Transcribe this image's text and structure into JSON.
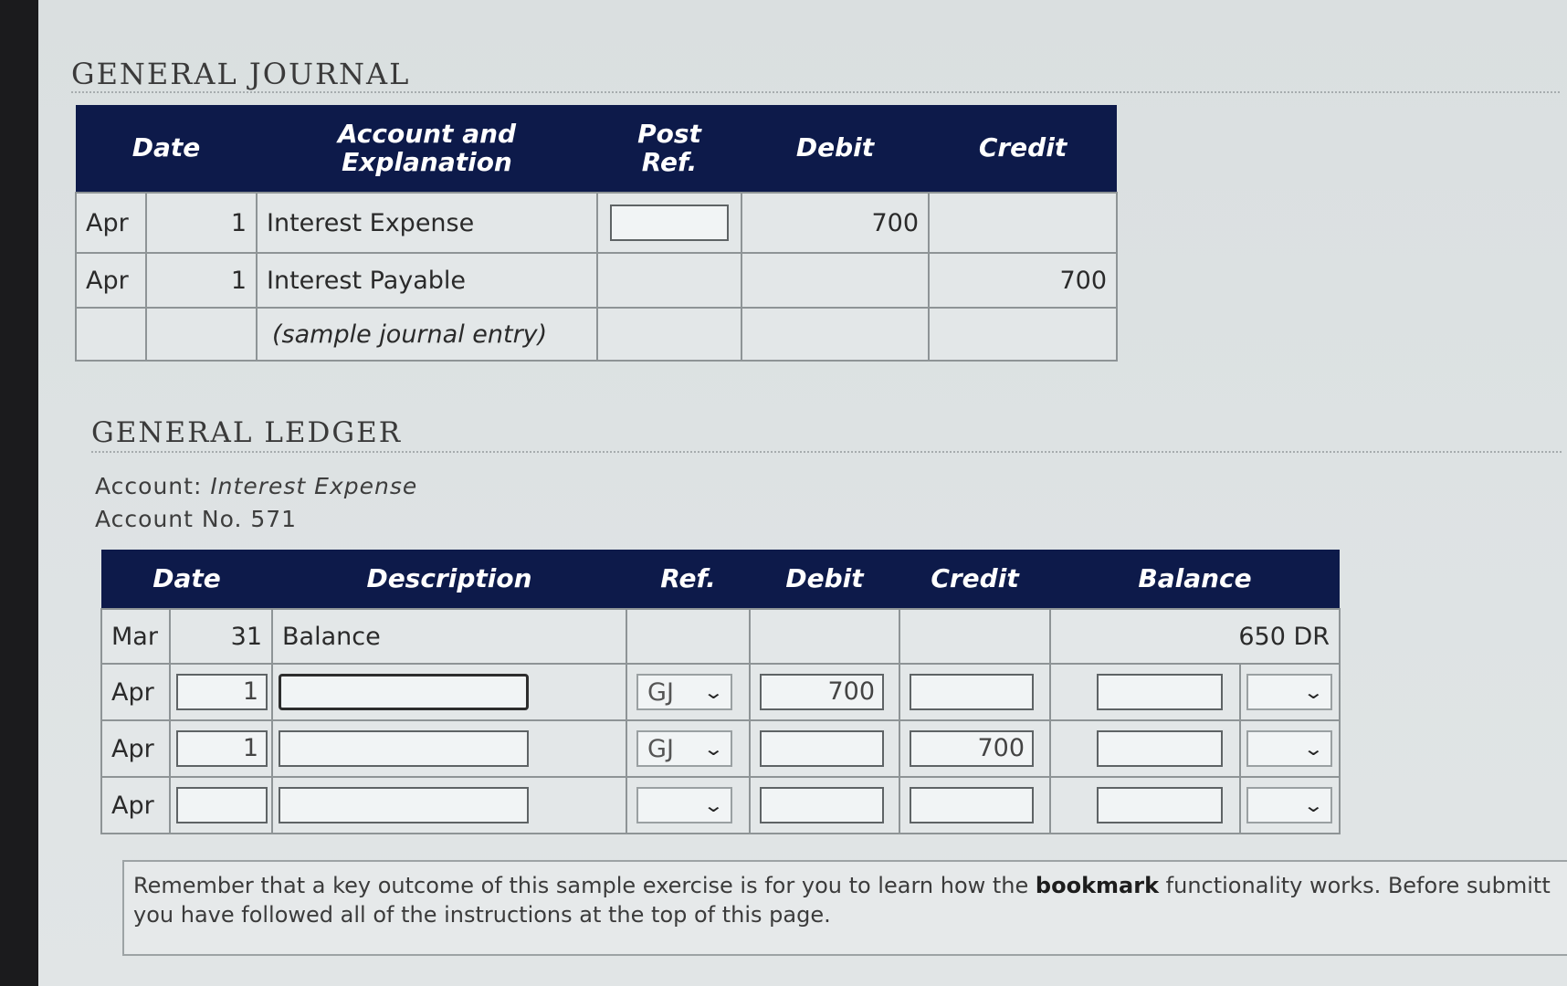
{
  "journal": {
    "title": "GENERAL JOURNAL",
    "headers": {
      "date": "Date",
      "account": "Account and Explanation",
      "post_ref_1": "Post",
      "post_ref_2": "Ref.",
      "debit": "Debit",
      "credit": "Credit"
    },
    "rows": [
      {
        "month": "Apr",
        "day": "1",
        "account": "Interest Expense",
        "debit": "700",
        "credit": ""
      },
      {
        "month": "Apr",
        "day": "1",
        "account": "Interest Payable",
        "debit": "",
        "credit": "700"
      },
      {
        "month": "",
        "day": "",
        "account": "(sample journal entry)",
        "debit": "",
        "credit": ""
      }
    ]
  },
  "ledger": {
    "title": "GENERAL LEDGER",
    "account_label": "Account: ",
    "account_name": "Interest Expense",
    "account_no": "Account No. 571",
    "headers": {
      "date": "Date",
      "description": "Description",
      "ref": "Ref.",
      "debit": "Debit",
      "credit": "Credit",
      "balance": "Balance"
    },
    "opening": {
      "month": "Mar",
      "day": "31",
      "description": "Balance",
      "balance": "650 DR"
    },
    "rows": [
      {
        "month": "Apr",
        "day": "1",
        "description": "",
        "ref": "GJ",
        "debit": "700",
        "credit": "",
        "balance": "",
        "balance_type": ""
      },
      {
        "month": "Apr",
        "day": "1",
        "description": "",
        "ref": "GJ",
        "debit": "",
        "credit": "700",
        "balance": "",
        "balance_type": ""
      },
      {
        "month": "Apr",
        "day": "",
        "description": "",
        "ref": "",
        "debit": "",
        "credit": "",
        "balance": "",
        "balance_type": ""
      }
    ]
  },
  "notice": {
    "part1": "Remember that a key outcome of this sample exercise is for you to learn how the ",
    "bold": "bookmark",
    "part2": " functionality works. Before submitt",
    "line2": "you have followed all of the instructions at the top of this page."
  },
  "icons": {
    "dropdown": "chevron-down-icon"
  }
}
